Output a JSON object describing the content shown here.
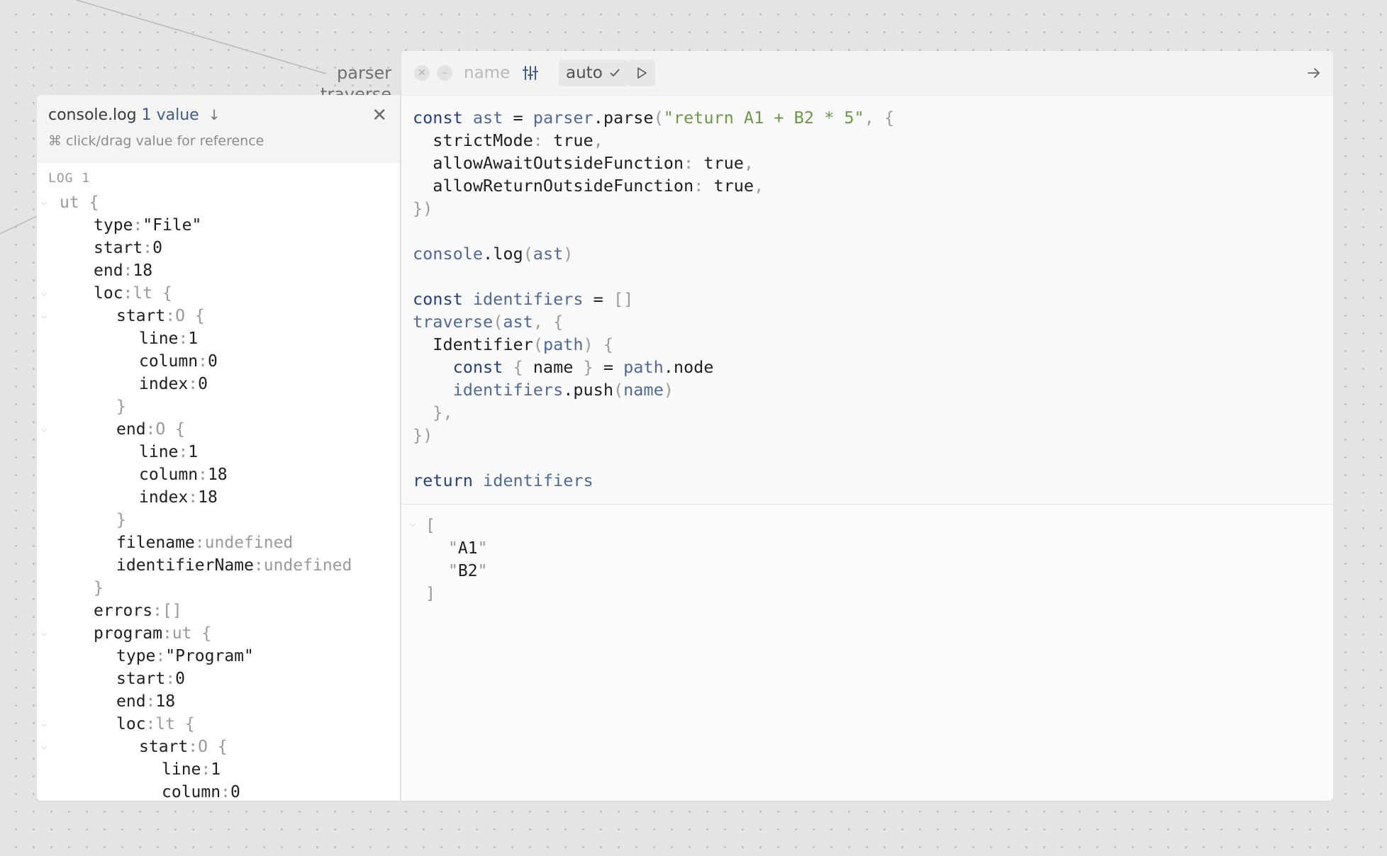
{
  "wire_labels": {
    "parser": "parser",
    "traverse": "traverse"
  },
  "console": {
    "title": "console.log",
    "count": "1 value",
    "download_icon": "arrow-down-icon",
    "close_icon": "close-icon",
    "hint": "⌘ click/drag value for reference",
    "log_label": "LOG 1",
    "tree": [
      {
        "d": 0,
        "tog": true,
        "t": "ut",
        "o": "{"
      },
      {
        "d": 1,
        "k": "type",
        "s": "\"File\""
      },
      {
        "d": 1,
        "k": "start",
        "n": "0"
      },
      {
        "d": 1,
        "k": "end",
        "n": "18"
      },
      {
        "d": 1,
        "tog": true,
        "k": "loc",
        "t": "lt",
        "o": "{"
      },
      {
        "d": 2,
        "tog": true,
        "k": "start",
        "t": "O",
        "o": "{"
      },
      {
        "d": 3,
        "k": "line",
        "n": "1"
      },
      {
        "d": 3,
        "k": "column",
        "n": "0"
      },
      {
        "d": 3,
        "k": "index",
        "n": "0"
      },
      {
        "d": 2,
        "cl": "}"
      },
      {
        "d": 2,
        "tog": true,
        "k": "end",
        "t": "O",
        "o": "{"
      },
      {
        "d": 3,
        "k": "line",
        "n": "1"
      },
      {
        "d": 3,
        "k": "column",
        "n": "18"
      },
      {
        "d": 3,
        "k": "index",
        "n": "18"
      },
      {
        "d": 2,
        "cl": "}"
      },
      {
        "d": 2,
        "k": "filename",
        "u": "undefined"
      },
      {
        "d": 2,
        "k": "identifierName",
        "u": "undefined"
      },
      {
        "d": 1,
        "cl": "}"
      },
      {
        "d": 1,
        "k": "errors",
        "b": "[]"
      },
      {
        "d": 1,
        "tog": true,
        "k": "program",
        "t": "ut",
        "o": "{"
      },
      {
        "d": 2,
        "k": "type",
        "s": "\"Program\""
      },
      {
        "d": 2,
        "k": "start",
        "n": "0"
      },
      {
        "d": 2,
        "k": "end",
        "n": "18"
      },
      {
        "d": 2,
        "tog": true,
        "k": "loc",
        "t": "lt",
        "o": "{"
      },
      {
        "d": 3,
        "tog": true,
        "k": "start",
        "t": "O",
        "o": "{"
      },
      {
        "d": 4,
        "k": "line",
        "n": "1"
      },
      {
        "d": 4,
        "k": "column",
        "n": "0"
      }
    ]
  },
  "toolbar": {
    "close_icon": "close-circle-icon",
    "minimize_icon": "minimize-circle-icon",
    "name_placeholder": "name",
    "settings_icon": "sliders-icon",
    "auto_label": "auto",
    "check_icon": "check-icon",
    "run_icon": "play-icon",
    "expand_icon": "arrow-right-icon"
  },
  "code_lines": [
    [
      [
        "kw",
        "const "
      ],
      [
        "vr",
        "ast"
      ],
      [
        "pr",
        " = "
      ],
      [
        "vr",
        "parser"
      ],
      [
        "pr",
        ".parse"
      ],
      [
        "pu",
        "("
      ],
      [
        "st",
        "\"return A1 + B2 * 5\""
      ],
      [
        "pu",
        ", {"
      ]
    ],
    [
      [
        "pr",
        "  strictMode"
      ],
      [
        "pu",
        ": "
      ],
      [
        "pr",
        "true"
      ],
      [
        "pu",
        ","
      ]
    ],
    [
      [
        "pr",
        "  allowAwaitOutsideFunction"
      ],
      [
        "pu",
        ": "
      ],
      [
        "pr",
        "true"
      ],
      [
        "pu",
        ","
      ]
    ],
    [
      [
        "pr",
        "  allowReturnOutsideFunction"
      ],
      [
        "pu",
        ": "
      ],
      [
        "pr",
        "true"
      ],
      [
        "pu",
        ","
      ]
    ],
    [
      [
        "pu",
        "})"
      ]
    ],
    [],
    [
      [
        "vr",
        "console"
      ],
      [
        "pr",
        ".log"
      ],
      [
        "pu",
        "("
      ],
      [
        "vr",
        "ast"
      ],
      [
        "pu",
        ")"
      ]
    ],
    [],
    [
      [
        "kw",
        "const "
      ],
      [
        "vr",
        "identifiers"
      ],
      [
        "pr",
        " = "
      ],
      [
        "pu",
        "[]"
      ]
    ],
    [
      [
        "vr",
        "traverse"
      ],
      [
        "pu",
        "("
      ],
      [
        "vr",
        "ast"
      ],
      [
        "pu",
        ", {"
      ]
    ],
    [
      [
        "pr",
        "  Identifier"
      ],
      [
        "pu",
        "("
      ],
      [
        "vr",
        "path"
      ],
      [
        "pu",
        ") {"
      ]
    ],
    [
      [
        "kw",
        "    const "
      ],
      [
        "pu",
        "{ "
      ],
      [
        "pr",
        "name"
      ],
      [
        "pu",
        " }"
      ],
      [
        "pr",
        " = "
      ],
      [
        "vr",
        "path"
      ],
      [
        "pr",
        ".node"
      ]
    ],
    [
      [
        "vr",
        "    identifiers"
      ],
      [
        "pr",
        ".push"
      ],
      [
        "pu",
        "("
      ],
      [
        "vr",
        "name"
      ],
      [
        "pu",
        ")"
      ]
    ],
    [
      [
        "pu",
        "  },"
      ]
    ],
    [
      [
        "pu",
        "})"
      ]
    ],
    [],
    [
      [
        "kw",
        "return "
      ],
      [
        "vr",
        "identifiers"
      ]
    ]
  ],
  "result": {
    "open": "[",
    "items": [
      "A1",
      "B2"
    ],
    "close": "]"
  }
}
